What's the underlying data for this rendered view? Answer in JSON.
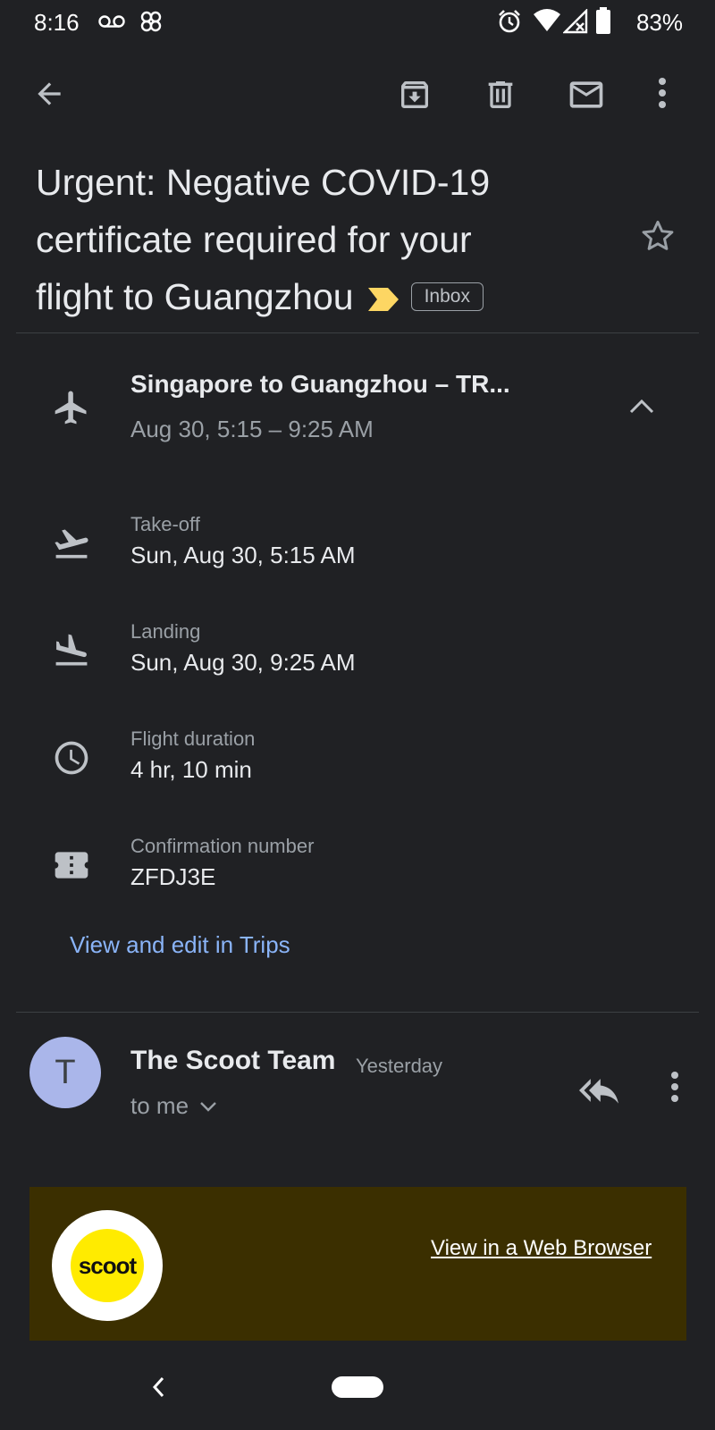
{
  "status_bar": {
    "time": "8:16",
    "battery_percent": "83%",
    "icons": [
      "voicemail-icon",
      "pinwheel-icon",
      "alarm-icon",
      "wifi-icon",
      "no-signal-icon",
      "battery-icon"
    ]
  },
  "toolbar": {
    "icons": [
      "back-arrow-icon",
      "archive-icon",
      "delete-icon",
      "mark-unread-icon",
      "more-vert-icon"
    ]
  },
  "email": {
    "subject_lines": [
      "Urgent: Negative COVID-19",
      "certificate required for your",
      "flight to Guangzhou"
    ],
    "label_chip": "Inbox",
    "important_color": "#fdd663"
  },
  "trip": {
    "title": "Singapore to Guangzhou – TR...",
    "subtitle": "Aug 30, 5:15 – 9:25 AM",
    "rows": [
      {
        "label": "Take-off",
        "value": "Sun, Aug 30, 5:15 AM",
        "icon": "takeoff-icon"
      },
      {
        "label": "Landing",
        "value": "Sun, Aug 30, 9:25 AM",
        "icon": "landing-icon"
      },
      {
        "label": "Flight duration",
        "value": "4 hr, 10 min",
        "icon": "clock-icon"
      },
      {
        "label": "Confirmation number",
        "value": "ZFDJ3E",
        "icon": "ticket-icon"
      }
    ],
    "link": "View and edit in Trips"
  },
  "message": {
    "avatar_letter": "T",
    "sender": "The Scoot Team",
    "time": "Yesterday",
    "recipient": "to me",
    "body": {
      "logo_text": "scoot",
      "web_link": "View in a Web Browser"
    }
  },
  "colors": {
    "background": "#202124",
    "link": "#8ab4f8",
    "avatar": "#aab6ea",
    "banner": "#3b2f00",
    "scoot_yellow": "#ffeb00"
  }
}
